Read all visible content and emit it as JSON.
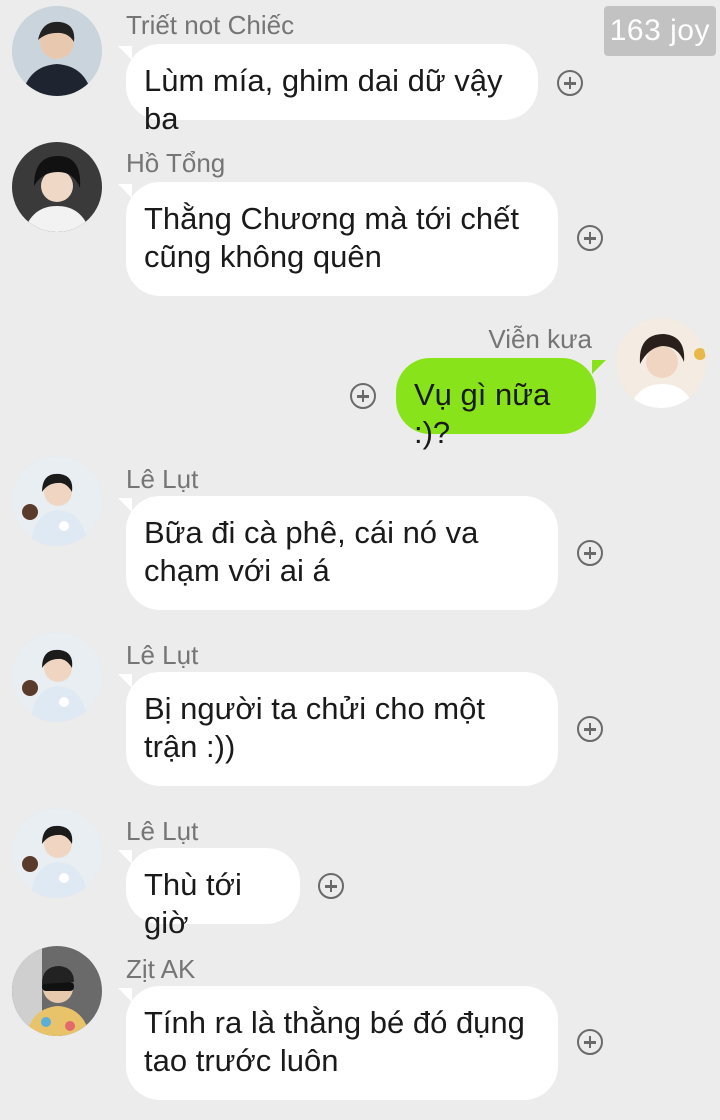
{
  "watermark": "163 joy",
  "colors": {
    "background": "#ececec",
    "incoming_bubble": "#ffffff",
    "outgoing_bubble": "#88e31a",
    "name_text": "#757575"
  },
  "messages": [
    {
      "sender": "Triết not Chiếc",
      "text": "Lùm mía, ghim dai dữ vậy ba",
      "direction": "incoming"
    },
    {
      "sender": "Hồ Tổng",
      "text": "Thằng Chương mà tới chết cũng không quên",
      "direction": "incoming"
    },
    {
      "sender": "Viễn kưa",
      "text": "Vụ gì nữa :)?",
      "direction": "outgoing"
    },
    {
      "sender": "Lê Lụt",
      "text": "Bữa đi cà phê, cái nó va chạm với ai á",
      "direction": "incoming"
    },
    {
      "sender": "Lê Lụt",
      "text": "Bị người ta chửi cho một trận :))",
      "direction": "incoming"
    },
    {
      "sender": "Lê Lụt",
      "text": "Thù tới giờ",
      "direction": "incoming"
    },
    {
      "sender": "Zịt AK",
      "text": "Tính ra là thằng bé đó đụng tao trước luôn",
      "direction": "incoming"
    }
  ],
  "icons": {
    "reaction": "add-reaction-icon",
    "avatar": "avatar-photo"
  }
}
